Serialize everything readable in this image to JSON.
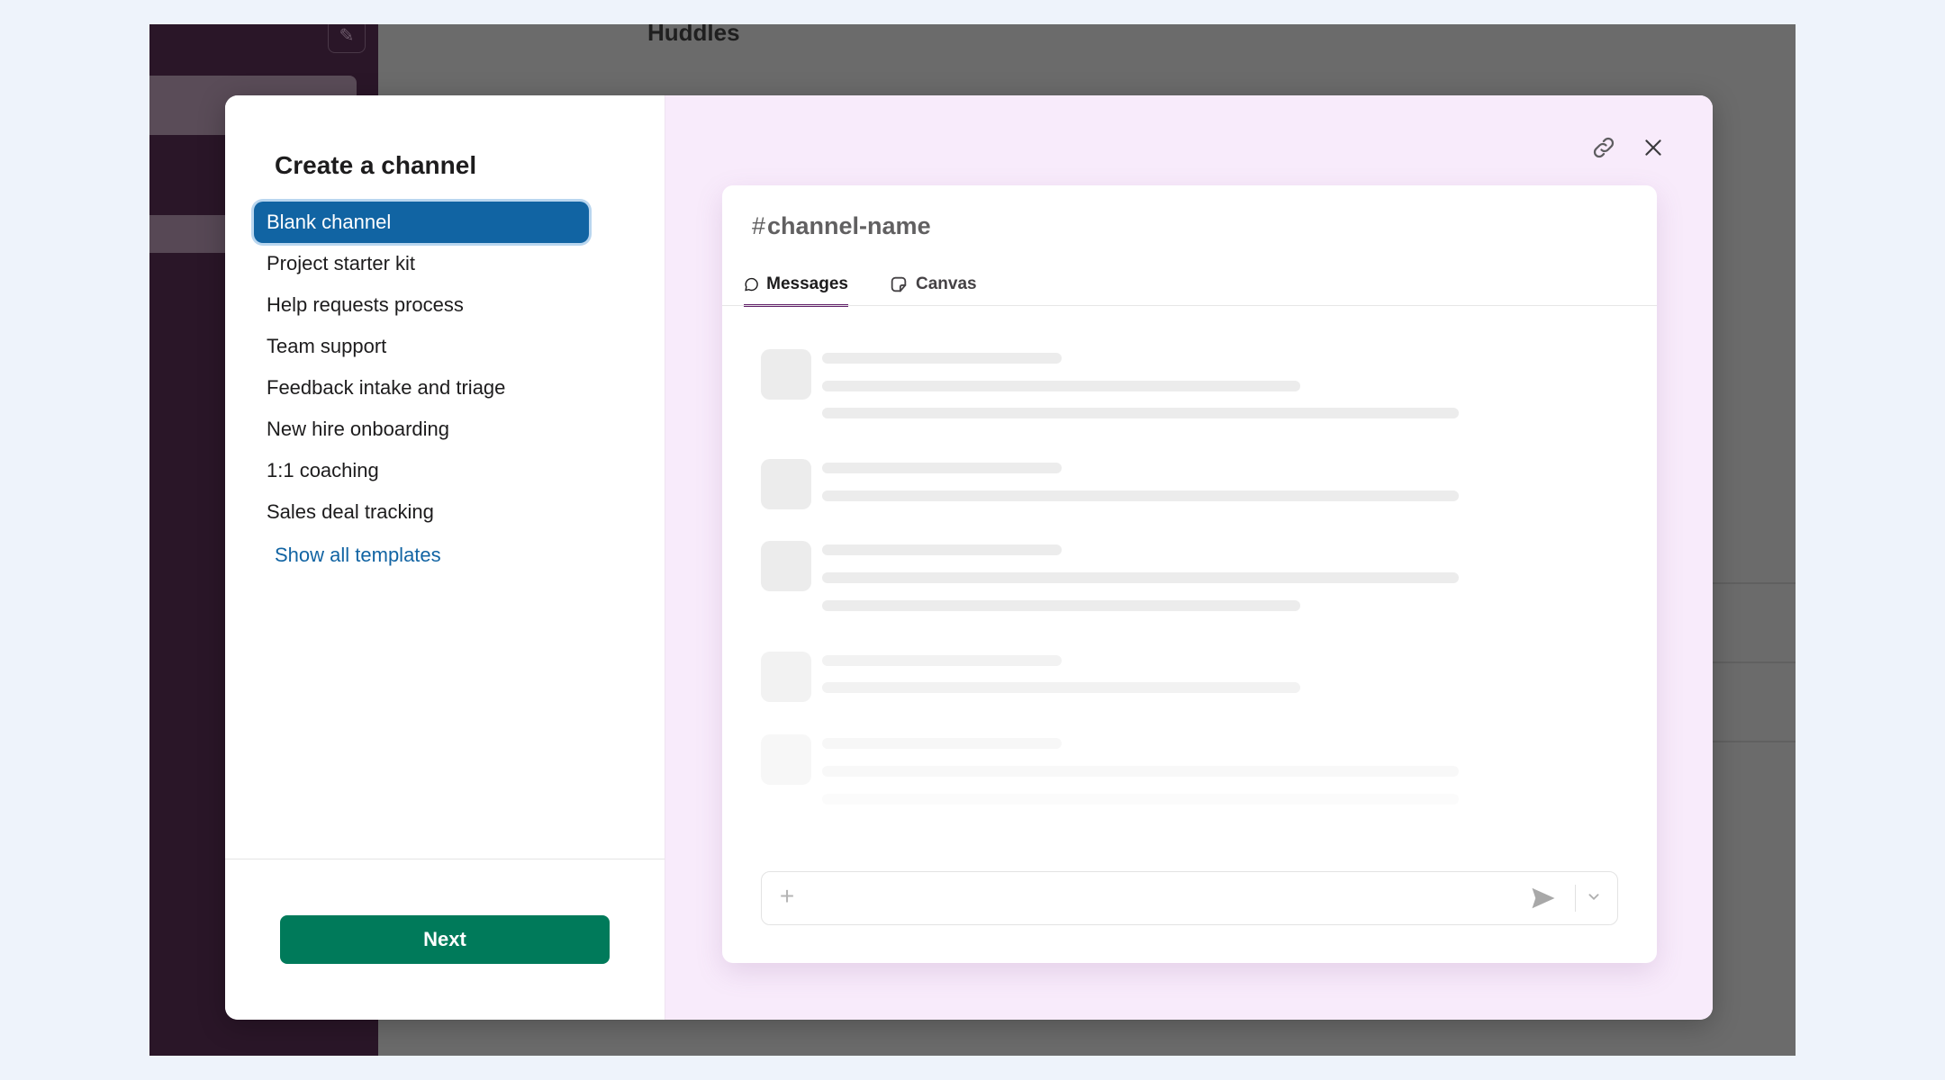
{
  "app": {
    "title": "Huddles"
  },
  "modal": {
    "title": "Create a channel",
    "templates": [
      {
        "label": "Blank channel",
        "selected": true
      },
      {
        "label": "Project starter kit",
        "selected": false
      },
      {
        "label": "Help requests process",
        "selected": false
      },
      {
        "label": "Team support",
        "selected": false
      },
      {
        "label": "Feedback intake and triage",
        "selected": false
      },
      {
        "label": "New hire onboarding",
        "selected": false
      },
      {
        "label": "1:1 coaching",
        "selected": false
      },
      {
        "label": "Sales deal tracking",
        "selected": false
      }
    ],
    "show_all_label": "Show all templates",
    "next_label": "Next"
  },
  "preview": {
    "hash": "#",
    "channel_name": "channel-name",
    "tabs": [
      {
        "label": "Messages",
        "icon": "message-bubble-icon",
        "active": true
      },
      {
        "label": "Canvas",
        "icon": "canvas-icon",
        "active": false
      }
    ]
  },
  "icons": {
    "link": "link-icon",
    "close": "close-icon",
    "add": "plus-icon",
    "send": "send-icon",
    "send_options": "chevron-down-icon"
  },
  "colors": {
    "selected_template": "#1164a3",
    "next_button": "#007a5a",
    "link_text": "#1264a3",
    "active_tab_underline": "#611f69",
    "preview_background": "#f8ebfb",
    "app_sidebar": "#2a1628"
  }
}
